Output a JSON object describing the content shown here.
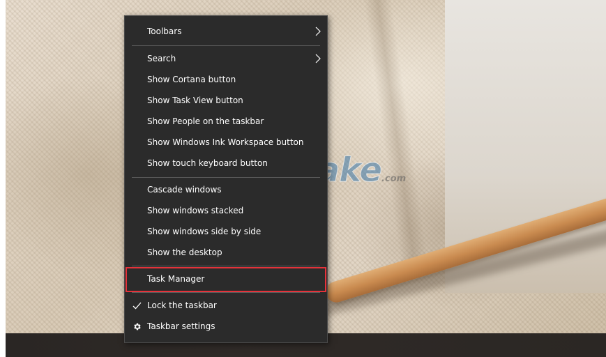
{
  "watermark": {
    "text": "TipsMake",
    "suffix": ".com"
  },
  "menu": {
    "toolbars": "Toolbars",
    "search": "Search",
    "show_cortana": "Show Cortana button",
    "show_task_view": "Show Task View button",
    "show_people": "Show People on the taskbar",
    "show_ink_workspace": "Show Windows Ink Workspace button",
    "show_touch_keyboard": "Show touch keyboard button",
    "cascade": "Cascade windows",
    "stacked": "Show windows stacked",
    "side_by_side": "Show windows side by side",
    "show_desktop": "Show the desktop",
    "task_manager": "Task Manager",
    "lock_taskbar": "Lock the taskbar",
    "taskbar_settings": "Taskbar settings"
  },
  "icons": {
    "submenu": "chevron-right-icon",
    "check": "checkmark-icon",
    "settings": "gear-icon"
  },
  "colors": {
    "menu_bg": "#2b2b2b",
    "menu_text": "#ffffff",
    "highlight_border": "#e5323a"
  }
}
